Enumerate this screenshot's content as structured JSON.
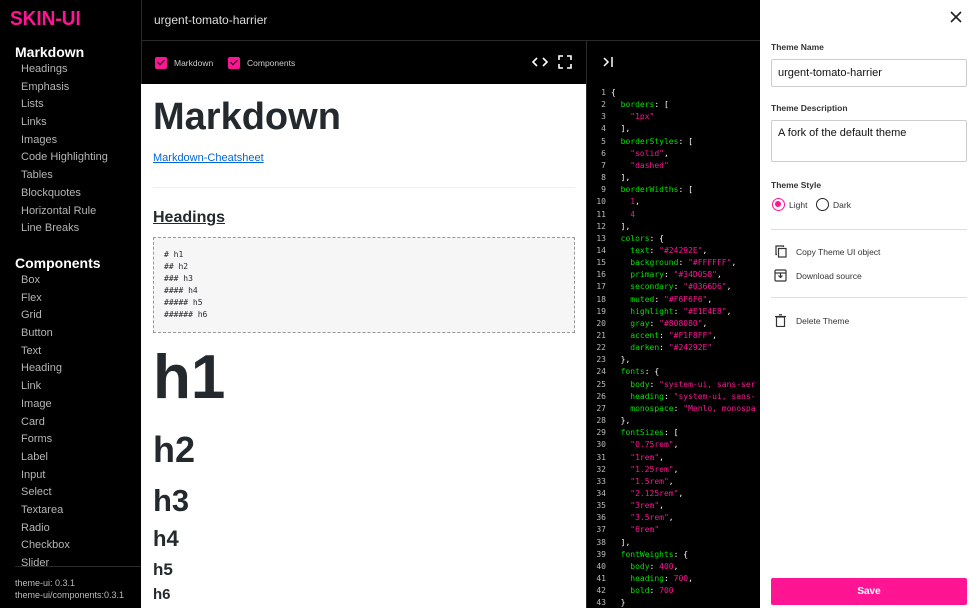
{
  "app": {
    "logo": "SKIN-UI",
    "theme_slug": "urgent-tomato-harrier"
  },
  "sidebar": {
    "markdown_title": "Markdown",
    "markdown_items": [
      "Headings",
      "Emphasis",
      "Lists",
      "Links",
      "Images",
      "Code Highlighting",
      "Tables",
      "Blockquotes",
      "Horizontal Rule",
      "Line Breaks"
    ],
    "components_title": "Components",
    "components_items": [
      "Box",
      "Flex",
      "Grid",
      "Button",
      "Text",
      "Heading",
      "Link",
      "Image",
      "Card",
      "Forms",
      "Label",
      "Input",
      "Select",
      "Textarea",
      "Radio",
      "Checkbox",
      "Slider"
    ],
    "versions": [
      "theme-ui: 0.3.1",
      "theme-ui/components:0.3.1"
    ]
  },
  "toolbar": {
    "markdown_label": "Markdown",
    "components_label": "Components",
    "code_icon": "code-icon",
    "fullscreen_icon": "fullscreen-icon",
    "collapse_icon": "collapse-right-icon"
  },
  "preview": {
    "title": "Markdown",
    "link": "Markdown-Cheatsheet",
    "headings_title": "Headings",
    "code_lines": [
      "# h1",
      "## h2",
      "### h3",
      "#### h4",
      "##### h5",
      "###### h6"
    ],
    "h1": "h1",
    "h2": "h2",
    "h3": "h3",
    "h4": "h4",
    "h5": "h5",
    "h6": "h6"
  },
  "code": {
    "lines": [
      [
        {
          "t": "{",
          "c": "p"
        }
      ],
      [
        {
          "t": "  borders",
          "c": "k"
        },
        {
          "t": ": [",
          "c": "p"
        }
      ],
      [
        {
          "t": "    \"1px\"",
          "c": "s"
        }
      ],
      [
        {
          "t": "  ],",
          "c": "p"
        }
      ],
      [
        {
          "t": "  borderStyles",
          "c": "k"
        },
        {
          "t": ": [",
          "c": "p"
        }
      ],
      [
        {
          "t": "    \"solid\"",
          "c": "s"
        },
        {
          "t": ",",
          "c": "p"
        }
      ],
      [
        {
          "t": "    \"dashed\"",
          "c": "s"
        }
      ],
      [
        {
          "t": "  ],",
          "c": "p"
        }
      ],
      [
        {
          "t": "  borderWidths",
          "c": "k"
        },
        {
          "t": ": [",
          "c": "p"
        }
      ],
      [
        {
          "t": "    1",
          "c": "s"
        },
        {
          "t": ",",
          "c": "p"
        }
      ],
      [
        {
          "t": "    4",
          "c": "s"
        }
      ],
      [
        {
          "t": "  ],",
          "c": "p"
        }
      ],
      [
        {
          "t": "  colors",
          "c": "k"
        },
        {
          "t": ": {",
          "c": "p"
        }
      ],
      [
        {
          "t": "    text",
          "c": "k"
        },
        {
          "t": ": ",
          "c": "p"
        },
        {
          "t": "\"#24292E\"",
          "c": "s"
        },
        {
          "t": ",",
          "c": "p"
        }
      ],
      [
        {
          "t": "    background",
          "c": "k"
        },
        {
          "t": ": ",
          "c": "p"
        },
        {
          "t": "\"#FFFFFF\"",
          "c": "s"
        },
        {
          "t": ",",
          "c": "p"
        }
      ],
      [
        {
          "t": "    primary",
          "c": "k"
        },
        {
          "t": ": ",
          "c": "p"
        },
        {
          "t": "\"#34D058\"",
          "c": "s"
        },
        {
          "t": ",",
          "c": "p"
        }
      ],
      [
        {
          "t": "    secondary",
          "c": "k"
        },
        {
          "t": ": ",
          "c": "p"
        },
        {
          "t": "\"#0366D6\"",
          "c": "s"
        },
        {
          "t": ",",
          "c": "p"
        }
      ],
      [
        {
          "t": "    muted",
          "c": "k"
        },
        {
          "t": ": ",
          "c": "p"
        },
        {
          "t": "\"#F6F6F6\"",
          "c": "s"
        },
        {
          "t": ",",
          "c": "p"
        }
      ],
      [
        {
          "t": "    highlight",
          "c": "k"
        },
        {
          "t": ": ",
          "c": "p"
        },
        {
          "t": "\"#E1E4E8\"",
          "c": "s"
        },
        {
          "t": ",",
          "c": "p"
        }
      ],
      [
        {
          "t": "    gray",
          "c": "k"
        },
        {
          "t": ": ",
          "c": "p"
        },
        {
          "t": "\"#808080\"",
          "c": "s"
        },
        {
          "t": ",",
          "c": "p"
        }
      ],
      [
        {
          "t": "    accent",
          "c": "k"
        },
        {
          "t": ": ",
          "c": "p"
        },
        {
          "t": "\"#F1F8FF\"",
          "c": "s"
        },
        {
          "t": ",",
          "c": "p"
        }
      ],
      [
        {
          "t": "    darken",
          "c": "k"
        },
        {
          "t": ": ",
          "c": "p"
        },
        {
          "t": "\"#24292E\"",
          "c": "s"
        }
      ],
      [
        {
          "t": "  },",
          "c": "p"
        }
      ],
      [
        {
          "t": "  fonts",
          "c": "k"
        },
        {
          "t": ": {",
          "c": "p"
        }
      ],
      [
        {
          "t": "    body",
          "c": "k"
        },
        {
          "t": ": ",
          "c": "p"
        },
        {
          "t": "\"system-ui, sans-ser",
          "c": "s"
        }
      ],
      [
        {
          "t": "    heading",
          "c": "k"
        },
        {
          "t": ": ",
          "c": "p"
        },
        {
          "t": "\"system-ui, sans-",
          "c": "s"
        }
      ],
      [
        {
          "t": "    monospace",
          "c": "k"
        },
        {
          "t": ": ",
          "c": "p"
        },
        {
          "t": "\"Menlo, monospa",
          "c": "s"
        }
      ],
      [
        {
          "t": "  },",
          "c": "p"
        }
      ],
      [
        {
          "t": "  fontSizes",
          "c": "k"
        },
        {
          "t": ": [",
          "c": "p"
        }
      ],
      [
        {
          "t": "    \"0.75rem\"",
          "c": "s"
        },
        {
          "t": ",",
          "c": "p"
        }
      ],
      [
        {
          "t": "    \"1rem\"",
          "c": "s"
        },
        {
          "t": ",",
          "c": "p"
        }
      ],
      [
        {
          "t": "    \"1.25rem\"",
          "c": "s"
        },
        {
          "t": ",",
          "c": "p"
        }
      ],
      [
        {
          "t": "    \"1.5rem\"",
          "c": "s"
        },
        {
          "t": ",",
          "c": "p"
        }
      ],
      [
        {
          "t": "    \"2.125rem\"",
          "c": "s"
        },
        {
          "t": ",",
          "c": "p"
        }
      ],
      [
        {
          "t": "    \"3rem\"",
          "c": "s"
        },
        {
          "t": ",",
          "c": "p"
        }
      ],
      [
        {
          "t": "    \"3.5rem\"",
          "c": "s"
        },
        {
          "t": ",",
          "c": "p"
        }
      ],
      [
        {
          "t": "    \"6rem\"",
          "c": "s"
        }
      ],
      [
        {
          "t": "  ],",
          "c": "p"
        }
      ],
      [
        {
          "t": "  fontWeights",
          "c": "k"
        },
        {
          "t": ": {",
          "c": "p"
        }
      ],
      [
        {
          "t": "    body",
          "c": "k"
        },
        {
          "t": ": ",
          "c": "p"
        },
        {
          "t": "400",
          "c": "s"
        },
        {
          "t": ",",
          "c": "p"
        }
      ],
      [
        {
          "t": "    heading",
          "c": "k"
        },
        {
          "t": ": ",
          "c": "p"
        },
        {
          "t": "700",
          "c": "s"
        },
        {
          "t": ",",
          "c": "p"
        }
      ],
      [
        {
          "t": "    bold",
          "c": "k"
        },
        {
          "t": ": ",
          "c": "p"
        },
        {
          "t": "700",
          "c": "s"
        }
      ],
      [
        {
          "t": "  }",
          "c": "p"
        }
      ]
    ]
  },
  "panel": {
    "name_label": "Theme Name",
    "name_value": "urgent-tomato-harrier",
    "desc_label": "Theme Description",
    "desc_value": "A fork of the default theme",
    "style_label": "Theme Style",
    "light_label": "Light",
    "dark_label": "Dark",
    "copy_label": "Copy Theme UI object",
    "download_label": "Download source",
    "delete_label": "Delete Theme",
    "save_label": "Save",
    "close_icon": "close-icon"
  },
  "colors": {
    "accent": "#ff1493",
    "code_key": "#00e000",
    "code_string": "#ff1493",
    "link": "#0366d6"
  }
}
